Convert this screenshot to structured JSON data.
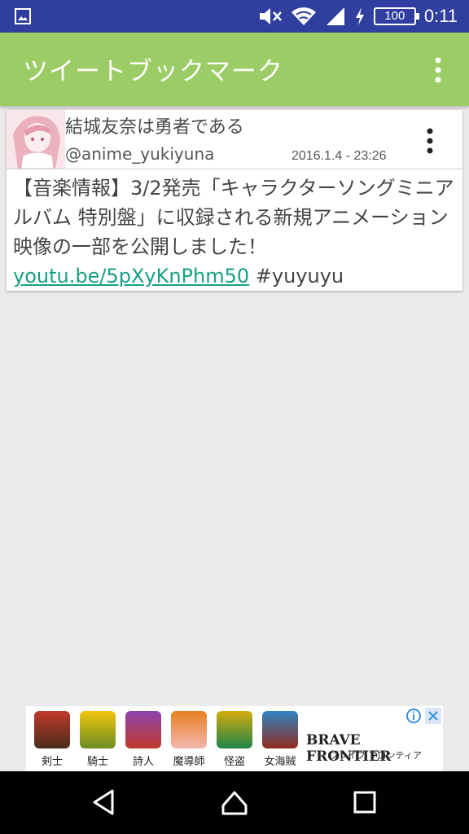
{
  "status_bar": {
    "time": "0:11",
    "battery": "100",
    "icons": [
      "image-icon",
      "mute-icon",
      "wifi-icon",
      "signal-icon",
      "charging-icon",
      "battery-icon"
    ]
  },
  "app_bar": {
    "title": "ツイートブックマーク",
    "color": "#9ccc65"
  },
  "tweet": {
    "name": "結城友奈は勇者である",
    "handle": "@anime_yukiyuna",
    "date": "2016.1.4 - 23:26",
    "text": "【音楽情報】3/2発売「キャラクターソングミニアルバム 特別盤」に収録される新規アニメーション映像の一部を公開しました！",
    "link": "youtu.be/5pXyKnPhm50",
    "hashtag": "#yuyuyu",
    "link_color": "#16a085"
  },
  "ad": {
    "labels": [
      "剣士",
      "騎士",
      "詩人",
      "魔導師",
      "怪盗",
      "女海賊"
    ],
    "brand": "BRAVE FRONTIER",
    "brand_sub": "ブレイブ フロンティア"
  }
}
